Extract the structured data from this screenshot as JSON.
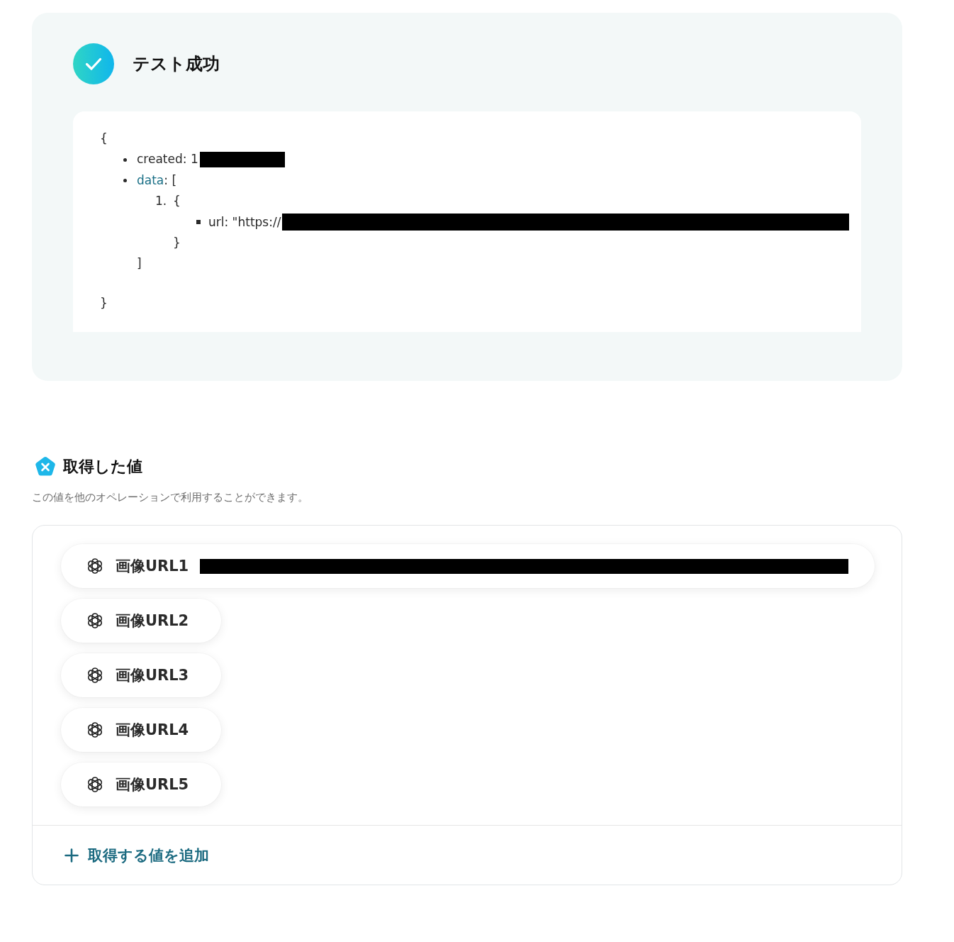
{
  "result_card": {
    "status": "テスト成功",
    "response": {
      "open": "{",
      "items": [
        {
          "kind": "field",
          "text": "created: 1",
          "redacted": true
        },
        {
          "kind": "array",
          "key": "data",
          "open": ": [",
          "items": [
            {
              "kind": "object",
              "marker": "1.",
              "open": "{",
              "items": [
                {
                  "kind": "field",
                  "text": "url: \"https://",
                  "redacted": true
                }
              ],
              "close": "}"
            }
          ],
          "close": "]"
        }
      ],
      "close": "}"
    }
  },
  "outputs_section": {
    "title": "取得した値",
    "description": "この値を他のオペレーションで利用することができます。",
    "values": [
      {
        "label": "画像URL1",
        "redacted": true
      },
      {
        "label": "画像URL2",
        "redacted": false
      },
      {
        "label": "画像URL3",
        "redacted": false
      },
      {
        "label": "画像URL4",
        "redacted": false
      },
      {
        "label": "画像URL5",
        "redacted": false
      }
    ],
    "add_button": {
      "label": "取得する値を追加"
    }
  }
}
